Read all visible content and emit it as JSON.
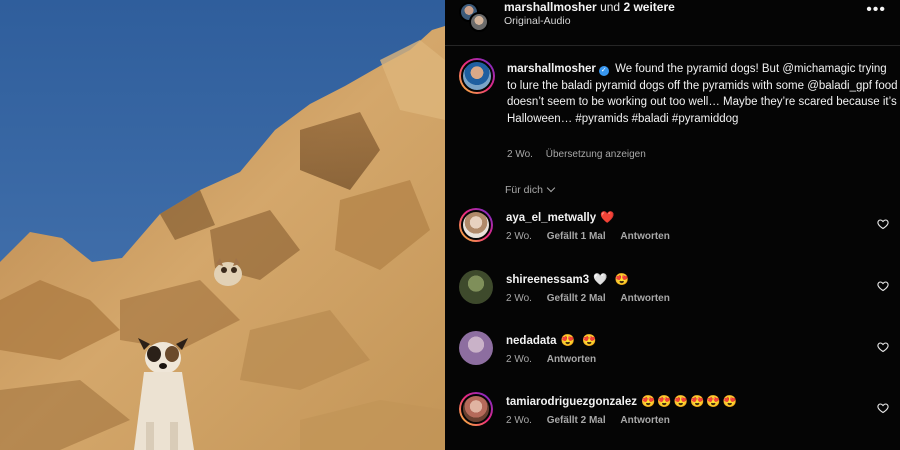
{
  "header": {
    "user": "marshallmosher",
    "and_text": "und",
    "more": "2 weitere",
    "audio": "Original-Audio",
    "menu_glyph": "•••"
  },
  "post": {
    "username": "marshallmosher",
    "verified_glyph": "✓",
    "caption": "We found the pyramid dogs! But @michamagic trying to lure the baladi pyramid dogs off the pyramids with some @baladi_gpf food doesn’t seem to be working out too well… Maybe they’re scared because it’s Halloween… #pyramids #baladi #pyramiddog",
    "age": "2 Wo.",
    "translate": "Übersetzung anzeigen"
  },
  "filter": {
    "label": "Für dich"
  },
  "comments": [
    {
      "user": "aya_el_metwally",
      "emoji": "❤️",
      "age": "2 Wo.",
      "likes": "Gefällt 1 Mal",
      "reply": "Antworten"
    },
    {
      "user": "shireenessam3",
      "emoji": "🤍 😍",
      "age": "2 Wo.",
      "likes": "Gefällt 2 Mal",
      "reply": "Antworten"
    },
    {
      "user": "nedadata",
      "emoji": "😍 😍",
      "age": "2 Wo.",
      "likes": "",
      "reply": "Antworten"
    },
    {
      "user": "tamiarodriguezgonzalez",
      "emoji": "😍😍😍😍😍😍",
      "age": "2 Wo.",
      "likes": "Gefällt 2 Mal",
      "reply": "Antworten"
    }
  ],
  "colors": {
    "background": "#000000",
    "secondary_text": "#a8a8a8",
    "verified": "#3897f0",
    "sky": "#3b6aa6",
    "rock": "#c99a5e"
  }
}
